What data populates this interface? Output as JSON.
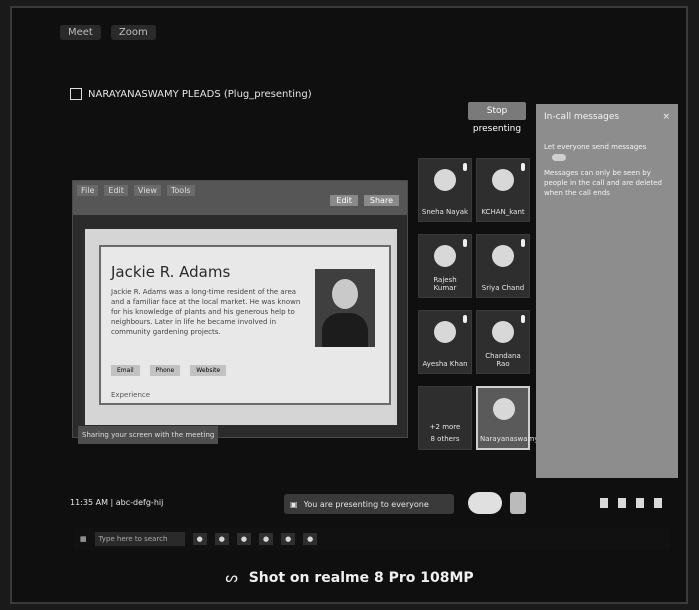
{
  "meeting": {
    "title": "NARAYANASWAMY PLEADS (Plug_presenting)"
  },
  "screen_share": {
    "doc_name": "Jackie R. Adams",
    "bio_text": "Jackie R. Adams was a long-time resident of the area and a familiar face at the local market. He was known for his knowledge of plants and his generous help to neighbours. Later in life he became involved in community gardening projects.",
    "notice": "Sharing your screen with the meeting"
  },
  "participants": [
    {
      "name": "Sneha Nayak"
    },
    {
      "name": "KCHAN_kant"
    },
    {
      "name": "Rajesh Kumar"
    },
    {
      "name": "Sriya Chand"
    },
    {
      "name": "Ayesha Khan"
    },
    {
      "name": "Chandana Rao"
    },
    {
      "name": "+2 more",
      "sub": "8 others"
    },
    {
      "name": "Narayanaswamy"
    }
  ],
  "chat": {
    "title": "In-call messages",
    "toggle_label": "Let everyone send messages",
    "notice": "Messages can only be seen by people in the call and are deleted when the call ends"
  },
  "bottom_bar": {
    "time": "11:35 AM",
    "meeting_code": "abc-defg-hij",
    "status": "You are presenting to everyone"
  },
  "taskbar": {
    "search_placeholder": "Type here to search"
  },
  "watermark": {
    "text": "Shot on realme 8 Pro 108MP"
  }
}
